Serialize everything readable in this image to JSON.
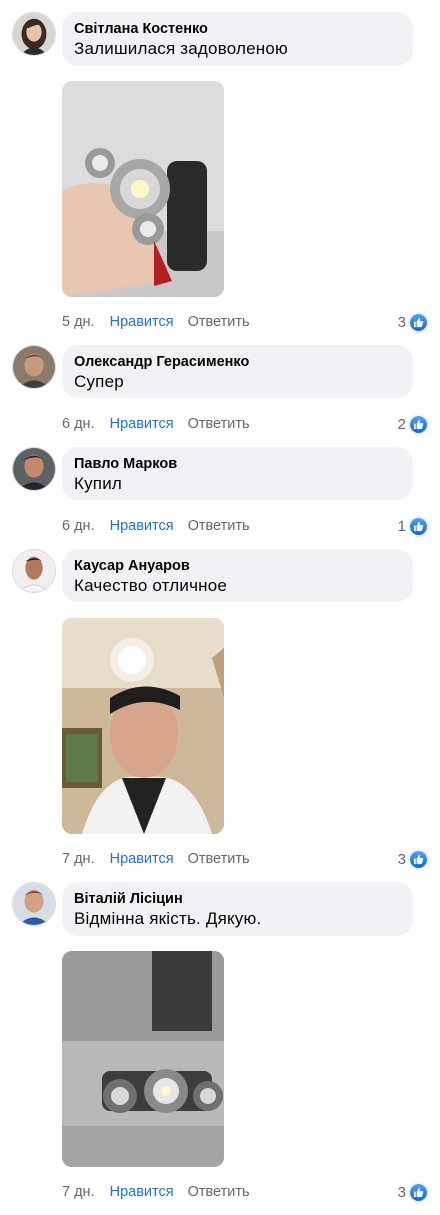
{
  "comments": [
    {
      "author": "Світлана Костенко",
      "text": "Залишилася задоволеною",
      "time": "5 дн.",
      "like_label": "Нравится",
      "reply_label": "Ответить",
      "reactions": "3",
      "avatar": "avatar-woman",
      "photo": "headlamp-in-hand"
    },
    {
      "author": "Олександр Герасименко",
      "text": "Супер",
      "time": "6 дн.",
      "like_label": "Нравится",
      "reply_label": "Ответить",
      "reactions": "2",
      "avatar": "avatar-man"
    },
    {
      "author": "Павло Марков",
      "text": "Купил",
      "time": "6 дн.",
      "like_label": "Нравится",
      "reply_label": "Ответить",
      "reactions": "1",
      "avatar": "avatar-man"
    },
    {
      "author": "Каусар Ануаров",
      "text": "Качество отличное",
      "time": "7 дн.",
      "like_label": "Нравится",
      "reply_label": "Ответить",
      "reactions": "3",
      "avatar": "avatar-man",
      "photo": "selfie-with-headlamp"
    },
    {
      "author": "Віталій Лісіцин",
      "text": "Відмінна якість. Дякую.",
      "time": "7 дн.",
      "like_label": "Нравится",
      "reply_label": "Ответить",
      "reactions": "3",
      "avatar": "avatar-man",
      "photo": "headlamp-closeup"
    }
  ],
  "colors": {
    "bubble": "#f0f2f5",
    "like_link": "#216fdb",
    "meta_text": "#65676b",
    "like_badge": "#1877f2"
  }
}
